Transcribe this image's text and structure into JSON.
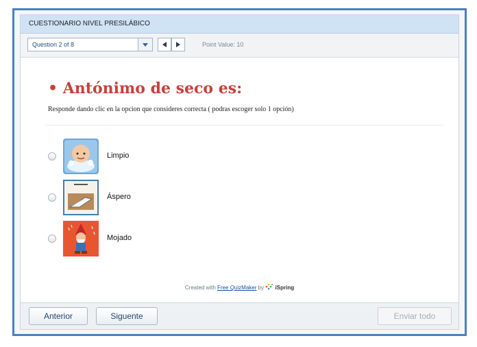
{
  "quiz": {
    "title": "CUESTIONARIO NIVEL PRESILÁBICO",
    "question_selector": "Question 2 of 8",
    "point_value": "Point Value: 10"
  },
  "question": {
    "title": "• Antónimo de seco es:",
    "instructions": "Responde dando clic en la opcion que consideres correcta ( podras escoger solo 1 opción)",
    "options": [
      {
        "label": "Limpio",
        "icon": "child-washing-icon"
      },
      {
        "label": "Áspero",
        "icon": "sandpaper-hand-icon"
      },
      {
        "label": "Mojado",
        "icon": "wet-gnome-icon"
      }
    ]
  },
  "credit": {
    "prefix": "Created with",
    "link": "Free QuizMaker",
    "by": "by",
    "brand": "iSpring"
  },
  "footer": {
    "prev_label": "Anterior",
    "next_label": "Siguente",
    "submit_label": "Enviar todo"
  },
  "colors": {
    "frame_border": "#4a7fc1",
    "title_bar": "#cfe3f5",
    "question_title": "#c4423c"
  }
}
